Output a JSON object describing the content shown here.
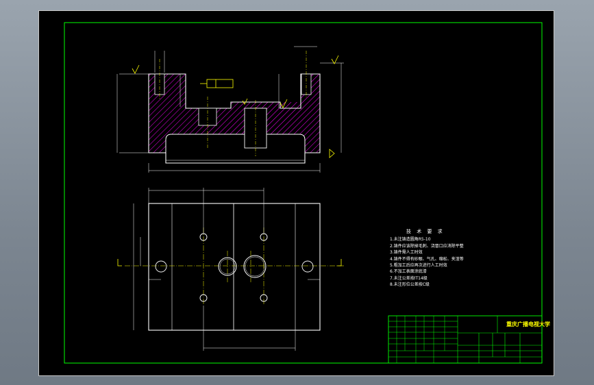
{
  "title_block": {
    "school_name": "重庆广播电视大学"
  },
  "technical_requirements": {
    "heading": "技 术 要 求",
    "items": [
      "1.未注铸造圆角R5-10",
      "2.铸件应该除掉毛刺、浇冒口应消除平整",
      "3.铸件需人工时效",
      "4.铸件不得有砂眼、气孔、缩松、夹渣等",
      "5.粗加工后应再次进行人工时效",
      "6.不加工表面涂底漆",
      "7.未注公差按IT14级",
      "8.未注形位公差按C级"
    ]
  },
  "colors": {
    "background": "#000000",
    "frame": "#00ff00",
    "outline": "#ffffff",
    "hatch": "#ff00ff",
    "text_accent": "#ffff00"
  }
}
